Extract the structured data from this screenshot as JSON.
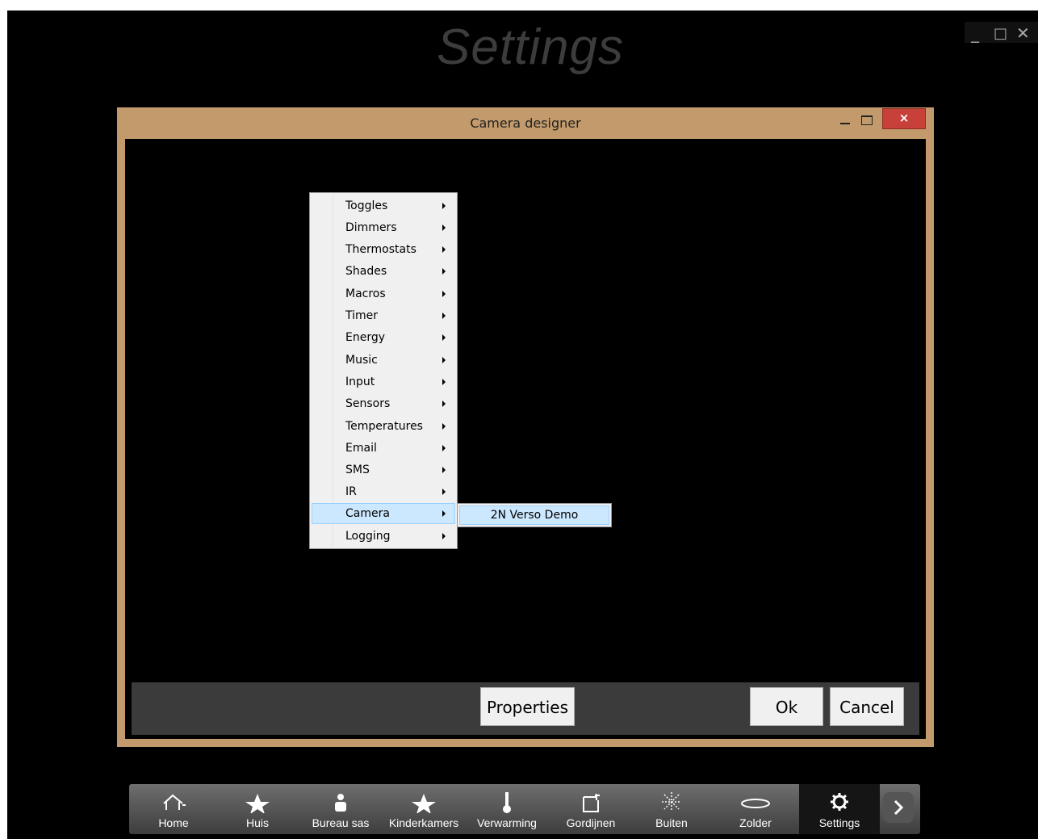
{
  "page": {
    "title": "Settings"
  },
  "app_window_controls": {
    "minimize": "_",
    "maximize": "□",
    "close": "✕"
  },
  "dialog": {
    "title": "Camera designer",
    "close_glyph": "×",
    "menu_items": [
      {
        "label": "Toggles"
      },
      {
        "label": "Dimmers"
      },
      {
        "label": "Thermostats"
      },
      {
        "label": "Shades"
      },
      {
        "label": "Macros"
      },
      {
        "label": "Timer"
      },
      {
        "label": "Energy"
      },
      {
        "label": "Music"
      },
      {
        "label": "Input"
      },
      {
        "label": "Sensors"
      },
      {
        "label": "Temperatures"
      },
      {
        "label": "Email"
      },
      {
        "label": "SMS"
      },
      {
        "label": "IR"
      },
      {
        "label": "Camera",
        "highlighted": true
      },
      {
        "label": "Logging"
      }
    ],
    "submenu_item": "2N Verso Demo",
    "buttons": {
      "properties": "Properties",
      "ok": "Ok",
      "cancel": "Cancel"
    }
  },
  "taskbar": {
    "items": [
      {
        "label": "Home",
        "icon": "house-icon"
      },
      {
        "label": "Huis",
        "icon": "star-icon"
      },
      {
        "label": "Bureau sas",
        "icon": "person-icon"
      },
      {
        "label": "Kinderkamers",
        "icon": "star-icon"
      },
      {
        "label": "Verwarming",
        "icon": "thermometer-icon"
      },
      {
        "label": "Gordijnen",
        "icon": "curtain-icon"
      },
      {
        "label": "Buiten",
        "icon": "sun-icon"
      },
      {
        "label": "Zolder",
        "icon": "ellipse-icon"
      },
      {
        "label": "Settings",
        "icon": "gear-icon",
        "active": true
      }
    ],
    "next_glyph": "›"
  },
  "colors": {
    "dialog_frame": "#c39a6b",
    "highlight": "#cce8ff",
    "close_button": "#c7413a"
  }
}
